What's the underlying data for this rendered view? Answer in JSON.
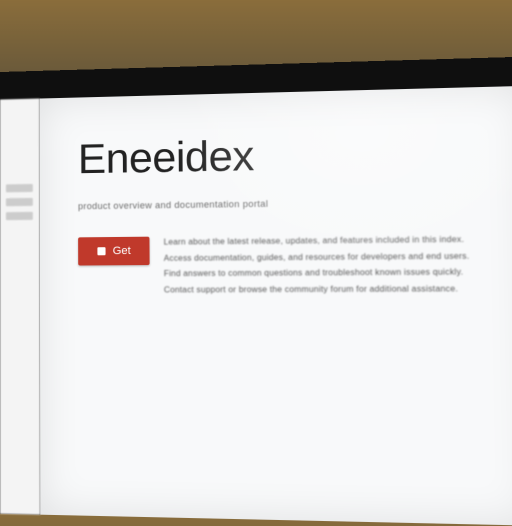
{
  "page": {
    "title": "Eneeidex",
    "subtitle": "product overview and documentation portal"
  },
  "actions": {
    "primary_label": "Get"
  },
  "body": {
    "line1": "Learn about the latest release, updates, and features included in this index.",
    "line2": "Access documentation, guides, and resources for developers and end users.",
    "line3": "Find answers to common questions and troubleshoot known issues quickly.",
    "line4": "Contact support or browse the community forum for additional assistance."
  },
  "colors": {
    "accent": "#c0392b"
  }
}
